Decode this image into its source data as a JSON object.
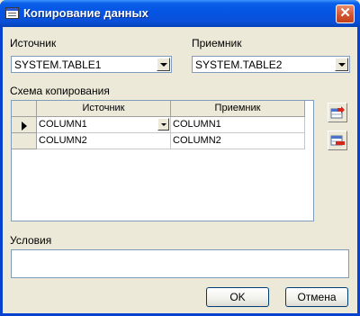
{
  "window": {
    "title": "Копирование данных"
  },
  "source": {
    "label": "Источник",
    "value": "SYSTEM.TABLE1"
  },
  "target": {
    "label": "Приемник",
    "value": "SYSTEM.TABLE2"
  },
  "mapping": {
    "label": "Схема копирования",
    "columns": [
      "Источник",
      "Приемник"
    ],
    "rows": [
      {
        "source": "COLUMN1",
        "target": "COLUMN1"
      },
      {
        "source": "COLUMN2",
        "target": "COLUMN2"
      }
    ]
  },
  "side_buttons": {
    "add_icon": "add-row-icon",
    "remove_icon": "remove-row-icon"
  },
  "conditions": {
    "label": "Условия",
    "value": ""
  },
  "buttons": {
    "ok": "OK",
    "cancel": "Отмена"
  }
}
